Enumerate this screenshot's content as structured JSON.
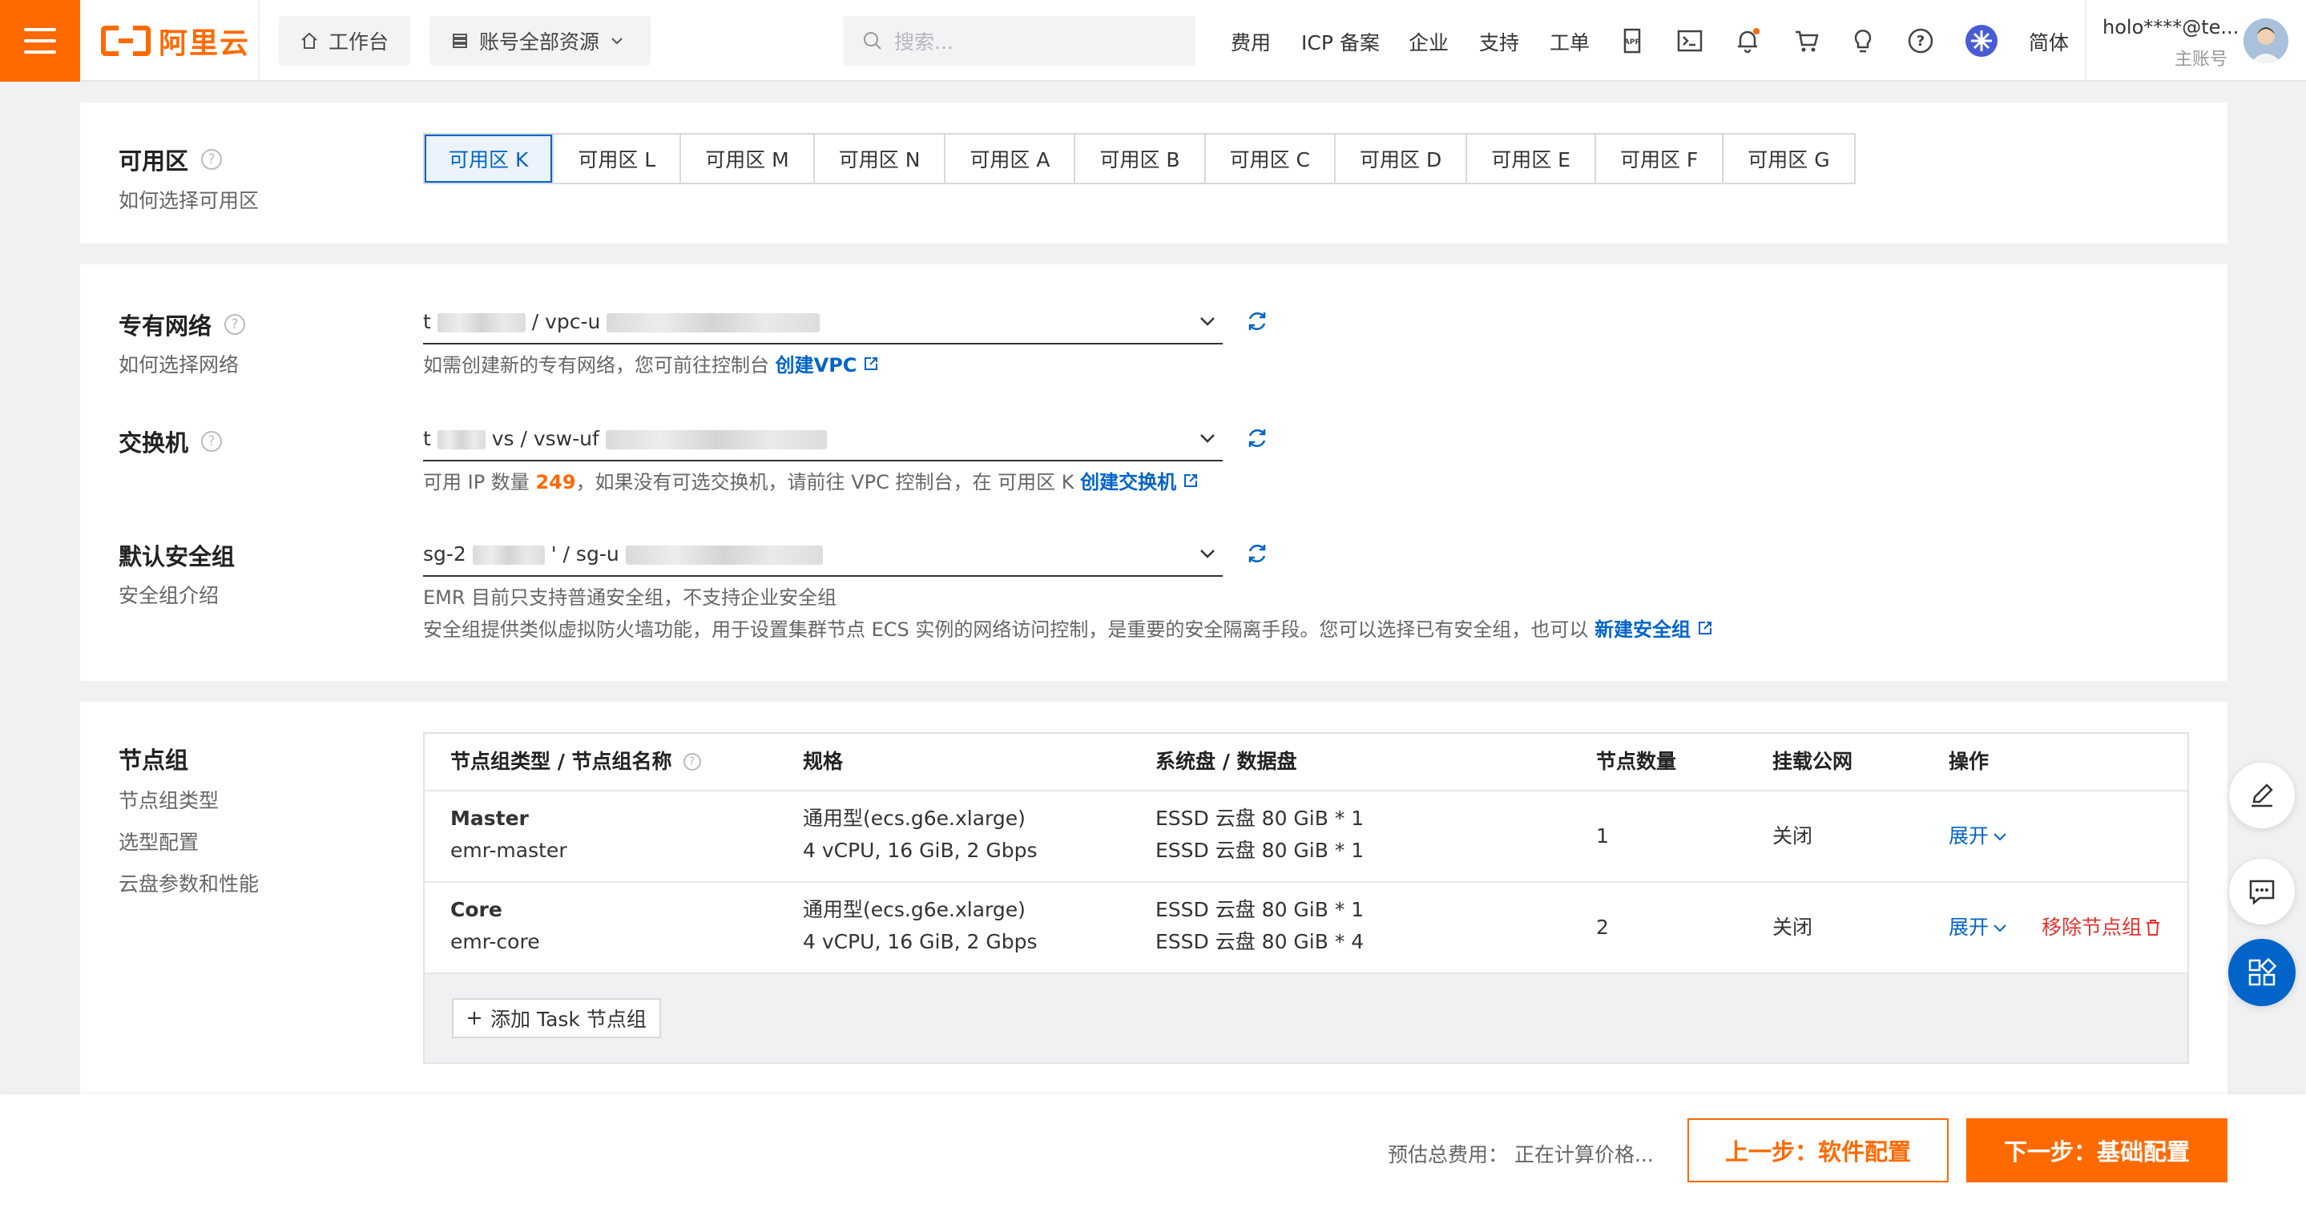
{
  "header": {
    "brand": "阿里云",
    "workbench": "工作台",
    "resource_scope": "账号全部资源",
    "search_placeholder": "搜索...",
    "nav": [
      "费用",
      "ICP 备案",
      "企业",
      "支持",
      "工单"
    ],
    "lang": "简体",
    "user_name": "holo****@te...",
    "user_sub": "主账号",
    "accent_color": "#ff6a00"
  },
  "zone": {
    "title": "可用区",
    "help_link": "如何选择可用区",
    "options": [
      "可用区 K",
      "可用区 L",
      "可用区 M",
      "可用区 N",
      "可用区 A",
      "可用区 B",
      "可用区 C",
      "可用区 D",
      "可用区 E",
      "可用区 F",
      "可用区 G"
    ],
    "selected": "可用区 K"
  },
  "network": {
    "vpc": {
      "title": "专有网络",
      "help_link": "如何选择网络",
      "value_prefix": "t",
      "value_mid": "/ vpc-u",
      "hint_text": "如需创建新的专有网络，您可前往控制台",
      "hint_link": "创建VPC"
    },
    "vswitch": {
      "title": "交换机",
      "value_prefix": "t",
      "value_mid": "vs / vsw-uf",
      "hint_before": "可用 IP 数量",
      "available_ips": "249",
      "hint_after": "，如果没有可选交换机，请前往 VPC 控制台，在 可用区 K",
      "hint_link": "创建交换机"
    },
    "security_group": {
      "title": "默认安全组",
      "help_link": "安全组介绍",
      "value_prefix": "sg-2",
      "value_mid": "' / sg-u",
      "hint1": "EMR 目前只支持普通安全组，不支持企业安全组",
      "hint2": "安全组提供类似虚拟防火墙功能，用于设置集群节点 ECS 实例的网络访问控制，是重要的安全隔离手段。您可以选择已有安全组，也可以",
      "hint_link": "新建安全组"
    }
  },
  "node_groups": {
    "title": "节点组",
    "links": [
      "节点组类型",
      "选型配置",
      "云盘参数和性能"
    ],
    "columns": [
      "节点组类型 / 节点组名称",
      "规格",
      "系统盘 / 数据盘",
      "节点数量",
      "挂载公网",
      "操作"
    ],
    "rows": [
      {
        "type": "Master",
        "name": "emr-master",
        "spec1": "通用型(ecs.g6e.xlarge)",
        "spec2": "4 vCPU, 16 GiB, 2 Gbps",
        "disk1": "ESSD 云盘 80 GiB * 1",
        "disk2": "ESSD 云盘 80 GiB * 1",
        "count": "1",
        "public": "关闭",
        "expand": "展开",
        "remove": ""
      },
      {
        "type": "Core",
        "name": "emr-core",
        "spec1": "通用型(ecs.g6e.xlarge)",
        "spec2": "4 vCPU, 16 GiB, 2 Gbps",
        "disk1": "ESSD 云盘 80 GiB * 1",
        "disk2": "ESSD 云盘 80 GiB * 4",
        "count": "2",
        "public": "关闭",
        "expand": "展开",
        "remove": "移除节点组"
      }
    ],
    "add_task": "添加 Task 节点组"
  },
  "footer": {
    "estimate_label": "预估总费用：",
    "estimate_value": "正在计算价格...",
    "prev_button": "上一步：软件配置",
    "next_button": "下一步：基础配置"
  }
}
